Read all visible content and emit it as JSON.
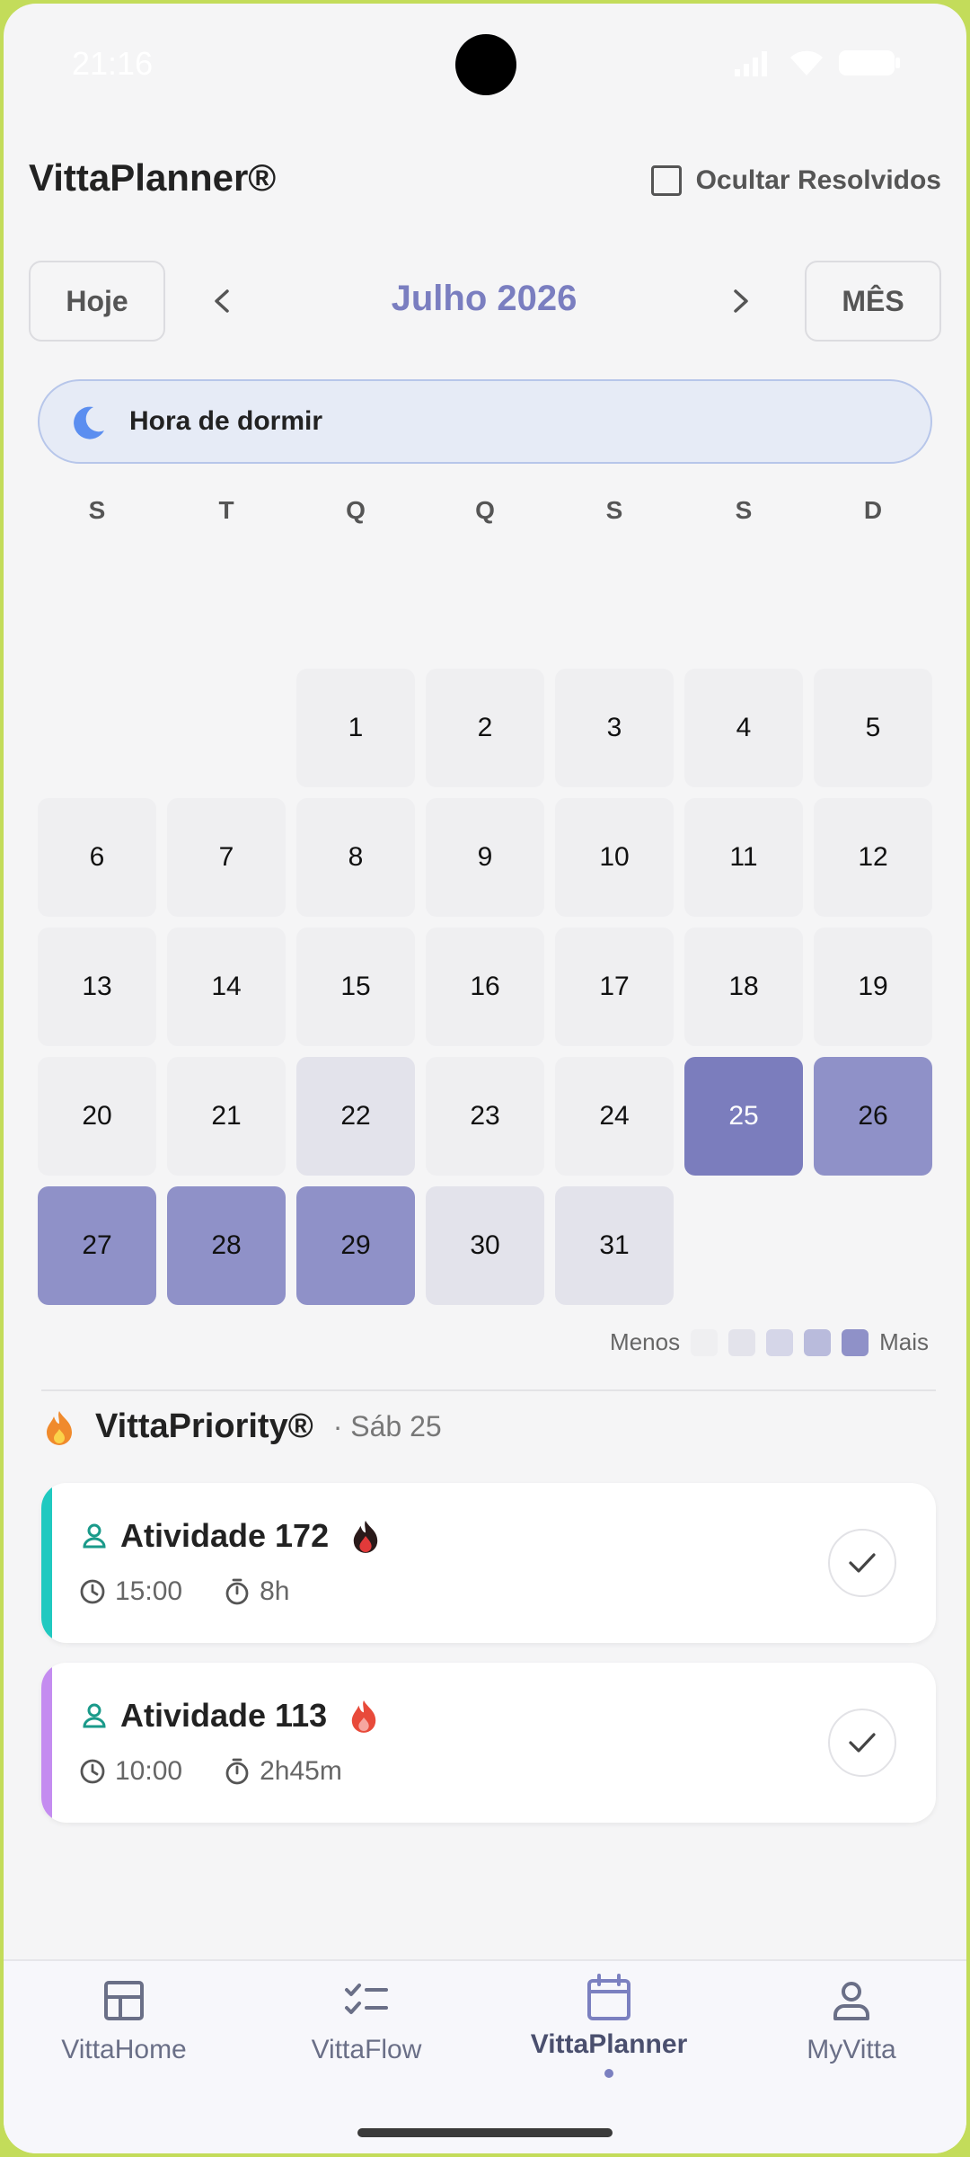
{
  "status_bar": {
    "time": "21:16"
  },
  "header": {
    "title": "VittaPlanner®",
    "hide_resolved_label": "Ocultar Resolvidos"
  },
  "month_nav": {
    "today_label": "Hoje",
    "month_label": "Julho 2026",
    "view_label": "MÊS"
  },
  "bedtime": {
    "label": "Hora de dormir"
  },
  "weekdays": [
    "S",
    "T",
    "Q",
    "Q",
    "S",
    "S",
    "D"
  ],
  "calendar": {
    "days": [
      {
        "d": "",
        "level": "blank"
      },
      {
        "d": "",
        "level": "blank"
      },
      {
        "d": "1",
        "level": "l0"
      },
      {
        "d": "2",
        "level": "l0"
      },
      {
        "d": "3",
        "level": "l0"
      },
      {
        "d": "4",
        "level": "l0"
      },
      {
        "d": "5",
        "level": "l0"
      },
      {
        "d": "6",
        "level": "l0"
      },
      {
        "d": "7",
        "level": "l0"
      },
      {
        "d": "8",
        "level": "l0"
      },
      {
        "d": "9",
        "level": "l0"
      },
      {
        "d": "10",
        "level": "l0"
      },
      {
        "d": "11",
        "level": "l0"
      },
      {
        "d": "12",
        "level": "l0"
      },
      {
        "d": "13",
        "level": "l0"
      },
      {
        "d": "14",
        "level": "l0"
      },
      {
        "d": "15",
        "level": "l0"
      },
      {
        "d": "16",
        "level": "l0"
      },
      {
        "d": "17",
        "level": "l0"
      },
      {
        "d": "18",
        "level": "l0"
      },
      {
        "d": "19",
        "level": "l0"
      },
      {
        "d": "20",
        "level": "l0"
      },
      {
        "d": "21",
        "level": "l0"
      },
      {
        "d": "22",
        "level": "l1"
      },
      {
        "d": "23",
        "level": "l0"
      },
      {
        "d": "24",
        "level": "l0"
      },
      {
        "d": "25",
        "level": "l4"
      },
      {
        "d": "26",
        "level": "l3"
      },
      {
        "d": "27",
        "level": "l3"
      },
      {
        "d": "28",
        "level": "l3"
      },
      {
        "d": "29",
        "level": "l3"
      },
      {
        "d": "30",
        "level": "l1"
      },
      {
        "d": "31",
        "level": "l1"
      }
    ]
  },
  "legend": {
    "less": "Menos",
    "more": "Mais",
    "colors": [
      "#efeff1",
      "#e3e3eb",
      "#d5d6e8",
      "#b9bbdc",
      "#8f91c8"
    ]
  },
  "priority": {
    "title": "VittaPriority®",
    "date": "· Sáb 25",
    "tasks": [
      {
        "title": "Atividade 172",
        "time": "15:00",
        "duration": "8h",
        "stripe_color": "#20c9c0",
        "flame": "dark"
      },
      {
        "title": "Atividade 113",
        "time": "10:00",
        "duration": "2h45m",
        "stripe_color": "#c48cf0",
        "flame": "red"
      }
    ]
  },
  "bottom_nav": {
    "items": [
      {
        "label": "VittaHome",
        "icon": "dashboard-icon"
      },
      {
        "label": "VittaFlow",
        "icon": "checklist-icon"
      },
      {
        "label": "VittaPlanner",
        "icon": "calendar-icon",
        "active": true
      },
      {
        "label": "MyVitta",
        "icon": "person-icon"
      }
    ]
  },
  "colors": {
    "accent": "#7a7ec0",
    "background": "#f5f5f6"
  }
}
